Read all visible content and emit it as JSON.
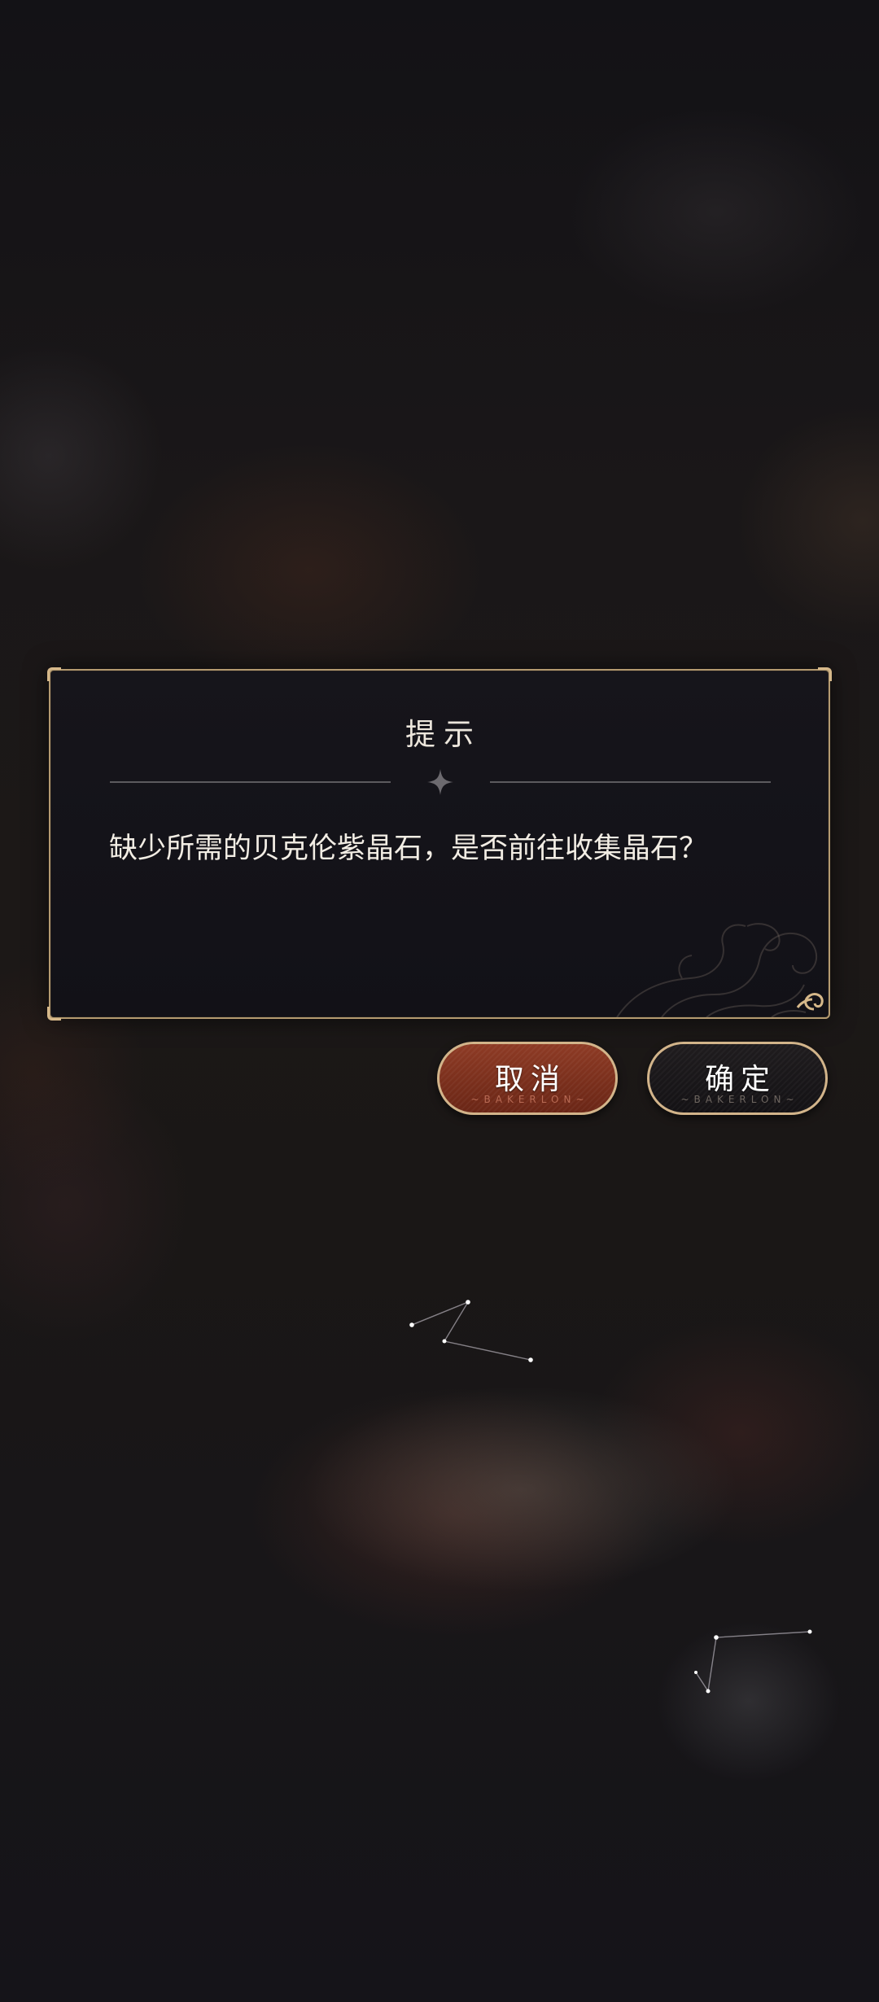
{
  "dialog": {
    "title": "提示",
    "message": "缺少所需的贝克伦紫晶石，是否前往收集晶石？"
  },
  "buttons": {
    "cancel": {
      "label": "取消",
      "sublabel": "~BAKERLON~"
    },
    "confirm": {
      "label": "确定",
      "sublabel": "~BAKERLON~"
    }
  },
  "icons": {
    "divider": "four-point-star-icon",
    "ornament": "baroque-flourish-icon"
  },
  "colors": {
    "frame_gold": "#b49a70",
    "dialog_bg": "#141318",
    "cancel_button": "#7a2f1c",
    "confirm_button": "#1a1719",
    "text": "#f2ede4"
  }
}
